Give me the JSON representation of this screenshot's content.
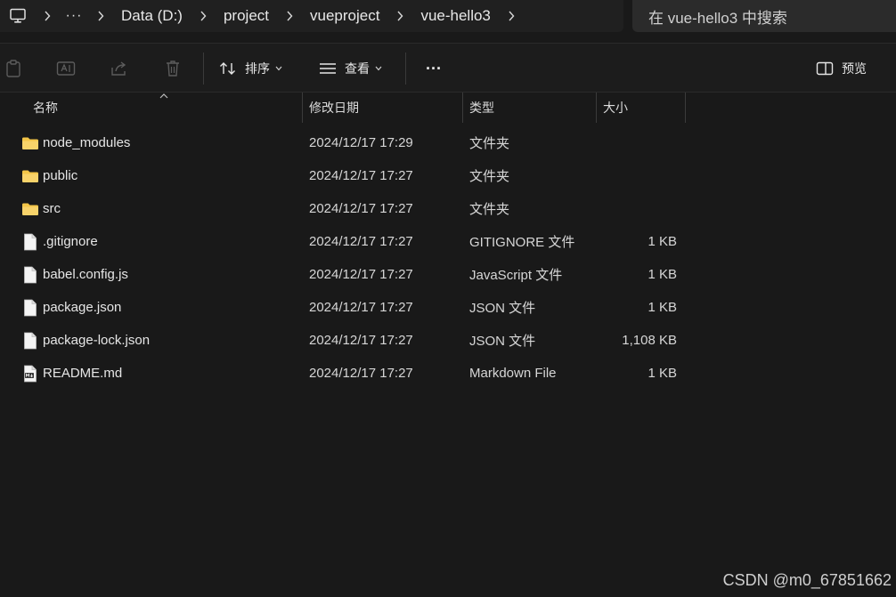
{
  "address_bar": {
    "more_label": "···",
    "crumbs": [
      "Data (D:)",
      "project",
      "vueproject",
      "vue-hello3"
    ]
  },
  "search": {
    "placeholder": "在 vue-hello3 中搜索"
  },
  "toolbar": {
    "sort_label": "排序",
    "view_label": "查看",
    "more_label": "···",
    "preview_label": "预览"
  },
  "columns": {
    "name": "名称",
    "date": "修改日期",
    "type": "类型",
    "size": "大小"
  },
  "files": [
    {
      "name": "node_modules",
      "date": "2024/12/17 17:29",
      "type": "文件夹",
      "size": "",
      "icon": "folder-icon"
    },
    {
      "name": "public",
      "date": "2024/12/17 17:27",
      "type": "文件夹",
      "size": "",
      "icon": "folder-icon"
    },
    {
      "name": "src",
      "date": "2024/12/17 17:27",
      "type": "文件夹",
      "size": "",
      "icon": "folder-icon"
    },
    {
      "name": ".gitignore",
      "date": "2024/12/17 17:27",
      "type": "GITIGNORE 文件",
      "size": "1 KB",
      "icon": "file-icon"
    },
    {
      "name": "babel.config.js",
      "date": "2024/12/17 17:27",
      "type": "JavaScript 文件",
      "size": "1 KB",
      "icon": "file-icon"
    },
    {
      "name": "package.json",
      "date": "2024/12/17 17:27",
      "type": "JSON 文件",
      "size": "1 KB",
      "icon": "file-icon"
    },
    {
      "name": "package-lock.json",
      "date": "2024/12/17 17:27",
      "type": "JSON 文件",
      "size": "1,108 KB",
      "icon": "file-icon"
    },
    {
      "name": "README.md",
      "date": "2024/12/17 17:27",
      "type": "Markdown File",
      "size": "1 KB",
      "icon": "markdown-file-icon"
    }
  ],
  "watermark": "CSDN @m0_67851662",
  "colors": {
    "background": "#191919",
    "folder": "#f3c548",
    "text": "#e6e6e6"
  }
}
